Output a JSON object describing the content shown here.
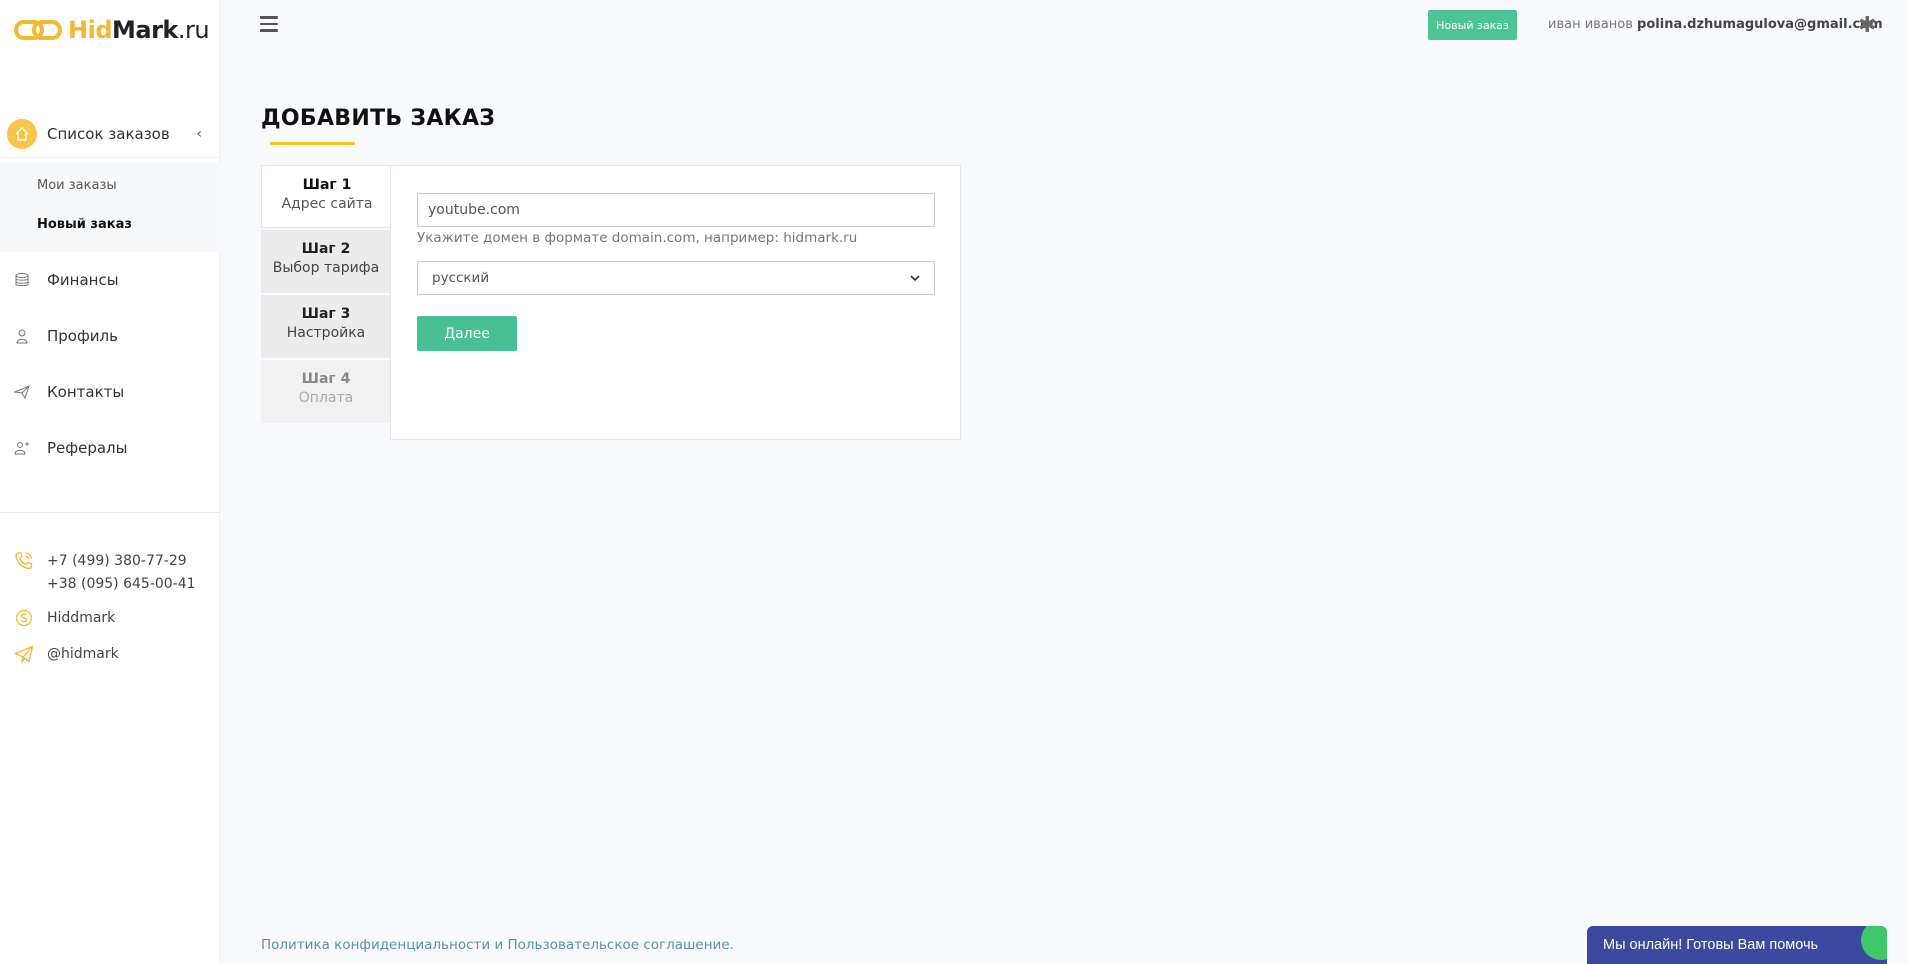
{
  "brand": {
    "logo_hid": "Hid",
    "logo_mark": "Mark",
    "logo_ru": ".ru",
    "accent": "#f5b82e"
  },
  "sidebar": {
    "active_section": "Список заказов",
    "sub_items": [
      {
        "label": "Мои заказы"
      },
      {
        "label": "Новый заказ"
      }
    ],
    "items": [
      {
        "label": "Финансы",
        "icon": "database-icon"
      },
      {
        "label": "Профиль",
        "icon": "user-icon"
      },
      {
        "label": "Контакты",
        "icon": "send-icon"
      },
      {
        "label": "Рефералы",
        "icon": "referral-icon"
      }
    ],
    "contacts": {
      "phone1": "+7 (499) 380-77-29",
      "phone2": "+38 (095) 645-00-41",
      "skype": "Hiddmark",
      "telegram": "@hidmark"
    }
  },
  "header": {
    "new_order_label": "Новый заказ",
    "user_name": "иван иванов",
    "user_email": "polina.dzhumagulova@gmail.com",
    "new_order_color": "#4cc495"
  },
  "main": {
    "title": "ДОБАВИТЬ ЗАКАЗ",
    "steps": [
      {
        "num": "Шаг 1",
        "name": "Адрес сайта"
      },
      {
        "num": "Шаг 2",
        "name": "Выбор тарифа"
      },
      {
        "num": "Шаг 3",
        "name": "Настройка"
      },
      {
        "num": "Шаг 4",
        "name": "Оплата"
      }
    ],
    "domain_value": "youtube.com",
    "hint": "Укажите домен в формате domain.com, например: hidmark.ru",
    "language_selected": "русский",
    "next_label": "Далее"
  },
  "footer": {
    "link_text": "Политика конфиденциальности и Пользовательское соглашение."
  },
  "chat": {
    "label": "Мы онлайн! Готовы Вам помочь"
  }
}
